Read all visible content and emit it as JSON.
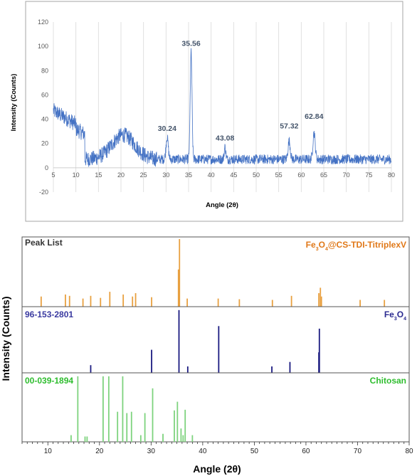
{
  "chart_data": [
    {
      "type": "line",
      "xlabel": "Angle (2θ)",
      "ylabel": "Intensity (Counts)",
      "xlim": [
        5,
        80
      ],
      "ylim": [
        -20,
        120
      ],
      "xticks": [
        "5",
        "10",
        "15",
        "20",
        "25",
        "30",
        "35",
        "40",
        "45",
        "50",
        "55",
        "60",
        "65",
        "70",
        "75",
        "80"
      ],
      "yticks": [
        "-20",
        "0",
        "20",
        "40",
        "60",
        "80",
        "100",
        "120"
      ],
      "grid": "vertical",
      "line_color": "#4472c4",
      "peak_labels": [
        {
          "x": 30.24,
          "y": 28,
          "label": "30.24"
        },
        {
          "x": 35.56,
          "y": 98,
          "label": "35.56"
        },
        {
          "x": 43.08,
          "y": 20,
          "label": "43.08"
        },
        {
          "x": 57.32,
          "y": 30,
          "label": "57.32"
        },
        {
          "x": 62.84,
          "y": 38,
          "label": "62.84"
        }
      ]
    },
    {
      "type": "bar",
      "xlabel": "Angle (2θ)",
      "ylabel": "Intensity (Counts)",
      "xlim": [
        5,
        80
      ],
      "xticks": [
        "10",
        "20",
        "30",
        "40",
        "50",
        "60",
        "70",
        "80"
      ],
      "panels": [
        {
          "left_label": "Peak List",
          "right_label_main": "Fe",
          "right_label_sub1": "3",
          "right_label_mid": "O",
          "right_label_sub2": "4",
          "right_label_tail": "@CS-TDI-TitriplexV",
          "color": "#e8a040",
          "left_color": "#333333",
          "right_color": "#e07818",
          "sticks": [
            [
              35.5,
              1.0
            ],
            [
              35.3,
              0.55
            ],
            [
              62.8,
              0.28
            ],
            [
              22.0,
              0.22
            ],
            [
              30.1,
              0.14
            ],
            [
              18.3,
              0.16
            ],
            [
              26.4,
              0.15
            ],
            [
              43.0,
              0.12
            ],
            [
              57.2,
              0.16
            ],
            [
              24.6,
              0.18
            ],
            [
              8.7,
              0.15
            ],
            [
              14.2,
              0.16
            ],
            [
              16.8,
              0.12
            ],
            [
              27.0,
              0.2
            ],
            [
              37.0,
              0.12
            ],
            [
              53.5,
              0.1
            ],
            [
              62.5,
              0.2
            ],
            [
              63.0,
              0.15
            ],
            [
              70.5,
              0.1
            ],
            [
              75.2,
              0.1
            ],
            [
              13.4,
              0.18
            ],
            [
              20.2,
              0.13
            ],
            [
              47.1,
              0.11
            ]
          ]
        },
        {
          "left_label": "96-153-2801",
          "right_label_main": "Fe",
          "right_label_sub1": "3",
          "right_label_mid": "O",
          "right_label_sub2": "4",
          "right_label_tail": "",
          "color": "#1a1a80",
          "left_color": "#3a3aa0",
          "right_color": "#2a2a90",
          "sticks": [
            [
              18.3,
              0.12
            ],
            [
              30.1,
              0.36
            ],
            [
              35.4,
              0.98
            ],
            [
              37.1,
              0.1
            ],
            [
              43.1,
              0.73
            ],
            [
              53.4,
              0.1
            ],
            [
              56.9,
              0.17
            ],
            [
              62.6,
              0.69
            ],
            [
              62.5,
              0.32
            ]
          ]
        },
        {
          "left_label": "00-039-1894",
          "right_label_main": "Chitosan",
          "right_label_sub1": "",
          "right_label_mid": "",
          "right_label_sub2": "",
          "right_label_tail": "",
          "color": "#7ed37e",
          "left_color": "#2ebd2e",
          "right_color": "#2ebd2e",
          "sticks": [
            [
              14.5,
              0.1
            ],
            [
              15.8,
              0.98
            ],
            [
              17.2,
              0.08
            ],
            [
              17.6,
              0.08
            ],
            [
              20.7,
              0.98
            ],
            [
              21.8,
              0.98
            ],
            [
              23.5,
              0.45
            ],
            [
              24.5,
              0.98
            ],
            [
              25.3,
              0.43
            ],
            [
              26.2,
              0.45
            ],
            [
              28.0,
              0.1
            ],
            [
              28.8,
              0.43
            ],
            [
              30.3,
              0.8
            ],
            [
              32.3,
              0.12
            ],
            [
              34.5,
              0.47
            ],
            [
              35.1,
              0.6
            ],
            [
              35.8,
              0.2
            ],
            [
              36.2,
              0.1
            ],
            [
              36.6,
              0.48
            ],
            [
              38.0,
              0.1
            ]
          ]
        }
      ]
    }
  ]
}
